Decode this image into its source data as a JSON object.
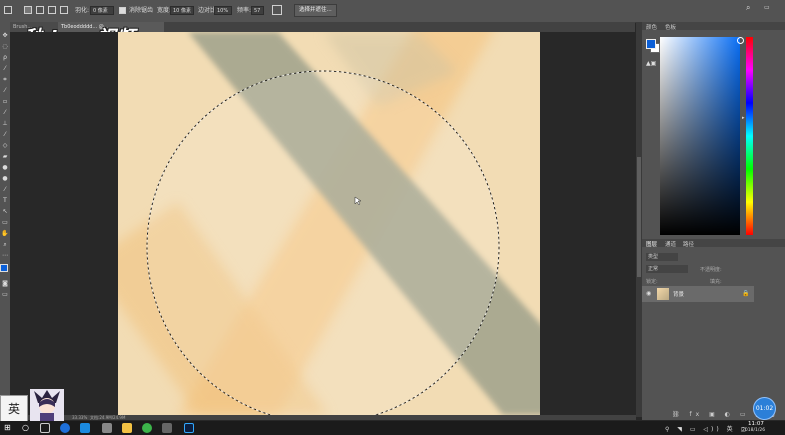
{
  "options_bar": {
    "feather_label": "羽化:",
    "feather_value": "0 像素",
    "antialias_label": "消除锯齿",
    "style_label": "样式:",
    "width_label": "宽度:",
    "width_value": "10 像素",
    "contrast_label": "边对比度:",
    "contrast_value": "10%",
    "frequency_label": "频率:",
    "frequency_value": "57",
    "select_mask_button": "选择并遮住..."
  },
  "document_tabs": [
    "Brush...",
    "Tb0eoddddd... @..."
  ],
  "watermark_logo": "秒dong视频",
  "status_bar": {
    "zoom": "33.33%",
    "doc_info": "文档:24.9M/24.9M"
  },
  "color_panel": {
    "tab_color": "颜色",
    "tab_swatches": "色板",
    "fg_color": "#0b5fd7",
    "bg_color": "#ffffff"
  },
  "layers_panel": {
    "tab_layers": "图层",
    "tab_channels": "通道",
    "tab_paths": "路径",
    "kind_label": "类型",
    "blend_mode": "正常",
    "opacity_label": "不透明度:",
    "fill_label": "填充:",
    "lock_label": "锁定:",
    "layer_name": "背景"
  },
  "subtitle_badge": "英",
  "recording_time": "01:02",
  "taskbar": {
    "time": "11:07",
    "date": "2018/1/26"
  }
}
